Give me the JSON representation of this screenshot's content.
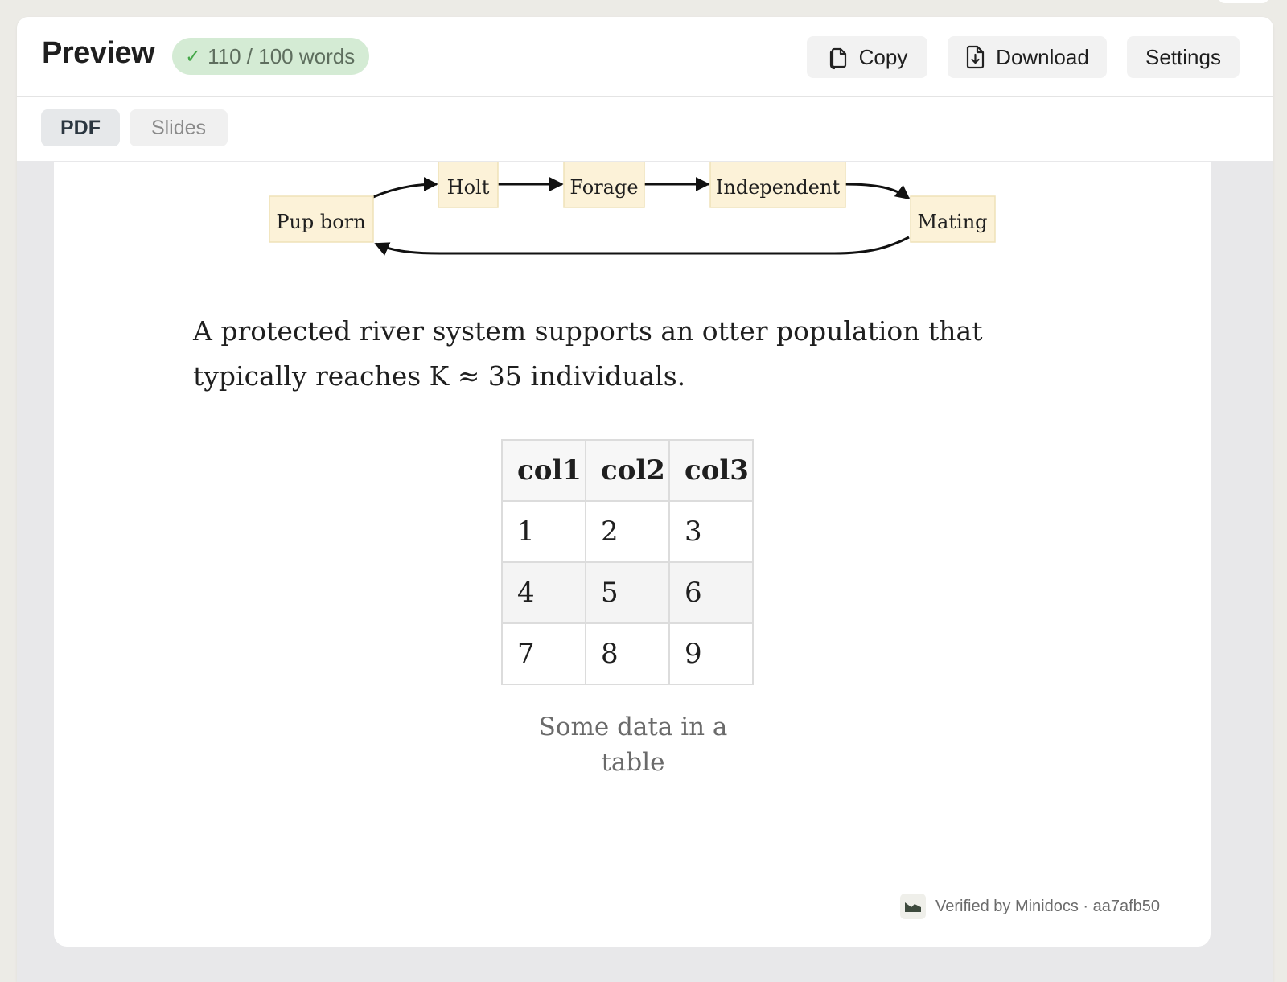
{
  "header": {
    "title": "Preview",
    "word_count": "110 / 100 words",
    "status_icon": "check-icon",
    "buttons": {
      "copy": "Copy",
      "download": "Download",
      "settings": "Settings"
    }
  },
  "tabs": [
    {
      "label": "PDF",
      "active": true
    },
    {
      "label": "Slides",
      "active": false
    }
  ],
  "diagram": {
    "nodes": [
      "Pup born",
      "Holt",
      "Forage",
      "Independent",
      "Mating"
    ],
    "edges": [
      [
        "Pup born",
        "Holt"
      ],
      [
        "Holt",
        "Forage"
      ],
      [
        "Forage",
        "Independent"
      ],
      [
        "Independent",
        "Mating"
      ],
      [
        "Mating",
        "Pup born"
      ]
    ]
  },
  "document": {
    "paragraph": "A protected river system supports an otter population that typically reaches K ≈ 35 individuals.",
    "table": {
      "headers": [
        "col1",
        "col2",
        "col3"
      ],
      "rows": [
        [
          "1",
          "2",
          "3"
        ],
        [
          "4",
          "5",
          "6"
        ],
        [
          "7",
          "8",
          "9"
        ]
      ],
      "caption": "Some data in a table"
    }
  },
  "footer": {
    "verified": "Verified by Minidocs · aa7afb50"
  },
  "colors": {
    "badge_bg": "#d4ebd4",
    "check": "#46a84a",
    "node_fill": "#fcf2d8"
  }
}
